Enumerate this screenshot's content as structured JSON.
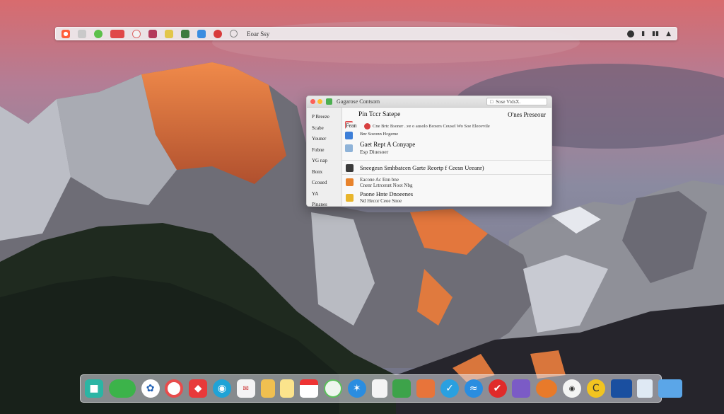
{
  "menubar": {
    "title": "Eoar Ssy",
    "icons": [
      "apple-icon",
      "finder-icon",
      "messages-icon",
      "mail-icon",
      "clock-icon",
      "calendar-icon",
      "notes-icon",
      "photos-icon",
      "files-icon",
      "music-icon"
    ],
    "status_icons": [
      "chrome-icon",
      "sound-icon",
      "wifi-icon",
      "cloud-icon"
    ]
  },
  "window": {
    "title": "Gagarose Contsom",
    "search_placeholder": "Sose VtdsX.",
    "sidebar_items": [
      "P Breeze",
      "Scabe",
      "Youner",
      "Fobne",
      "YG nap",
      "Bonx",
      "Ccoued",
      "YA",
      "Pinanes"
    ],
    "header_left": "Pin Tccr Satepe",
    "header_right": "O'nes Preseour",
    "rows": [
      {
        "main": "Fean",
        "sub": "Cne Brtc Bsoner ..ve o ausolo Boxers Cousel Wo Soe Eleovvile",
        "sub2": "Bnr Soeonn Hcgeme"
      },
      {
        "main": "Gaet Rept A Conyape",
        "sub": "Esp Diuesoer"
      },
      {
        "main": "Sneegesn Smhbatcen Garte Reortp f Ceesn Ueeanr)",
        "sub": ""
      },
      {
        "main": "",
        "sub": "Eacone Ac Enn bne",
        "sub2": "Cnenr Lrtrcennt Noot Nbg"
      },
      {
        "main": "Paone Hnte Dnoeenes",
        "sub": "Nd Hecor Ceoe Snoe"
      }
    ]
  },
  "dock": {
    "icons": [
      "finder-icon",
      "chat-icon",
      "safari-icon",
      "photos-icon",
      "news-icon",
      "maps-icon",
      "mail-icon",
      "notes-icon",
      "calendar-icon",
      "reminders-icon",
      "facetime-icon",
      "appstore-icon",
      "textedit-icon",
      "books-icon",
      "pages-icon",
      "keynote-icon",
      "messages-icon",
      "music-icon",
      "podcast-icon",
      "news2-icon",
      "preview-icon",
      "terminal-icon",
      "settings-icon",
      "trash-icon",
      "downloads-icon"
    ]
  }
}
